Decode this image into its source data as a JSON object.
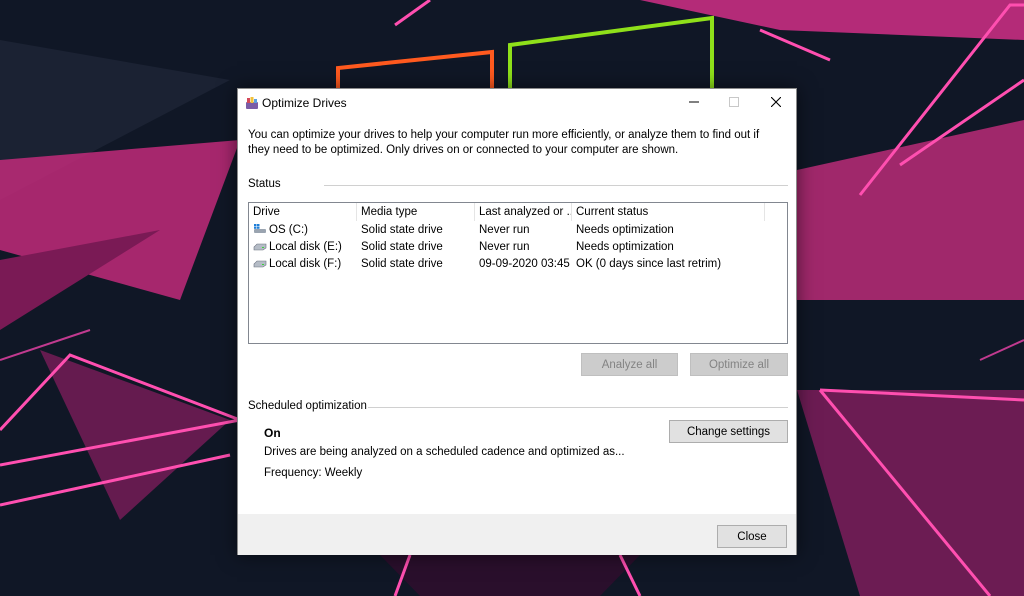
{
  "window": {
    "title": "Optimize Drives",
    "icon": "optimize-drives-app-icon",
    "controls": [
      "minimize-icon",
      "maximize-icon",
      "close-icon"
    ]
  },
  "description": "You can optimize your drives to help your computer run more efficiently, or analyze them to find out if they need to be optimized. Only drives on or connected to your computer are shown.",
  "status": {
    "label": "Status",
    "columns": [
      "Drive",
      "Media type",
      "Last analyzed or ...",
      "Current status"
    ],
    "rows": [
      {
        "drive": "OS (C:)",
        "icon": "windows-drive-icon",
        "media": "Solid state drive",
        "last": "Never run",
        "status": "Needs optimization"
      },
      {
        "drive": "Local disk (E:)",
        "icon": "hard-drive-icon",
        "media": "Solid state drive",
        "last": "Never run",
        "status": "Needs optimization"
      },
      {
        "drive": "Local disk (F:)",
        "icon": "hard-drive-icon",
        "media": "Solid state drive",
        "last": "09-09-2020 03:45",
        "status": "OK (0 days since last retrim)"
      }
    ]
  },
  "buttons": {
    "analyze_all": "Analyze all",
    "optimize_all": "Optimize all",
    "change_settings": "Change settings",
    "close": "Close"
  },
  "scheduled": {
    "label": "Scheduled optimization",
    "state": "On",
    "description": "Drives are being analyzed on a scheduled cadence and optimized as...",
    "frequency": "Frequency: Weekly"
  },
  "colors": {
    "wallpaper_bg": "#101726",
    "accent_pink": "#e0358a",
    "accent_orange": "#ff5a1f",
    "accent_green": "#8fe01a",
    "disabled_button": "#cccccc"
  }
}
